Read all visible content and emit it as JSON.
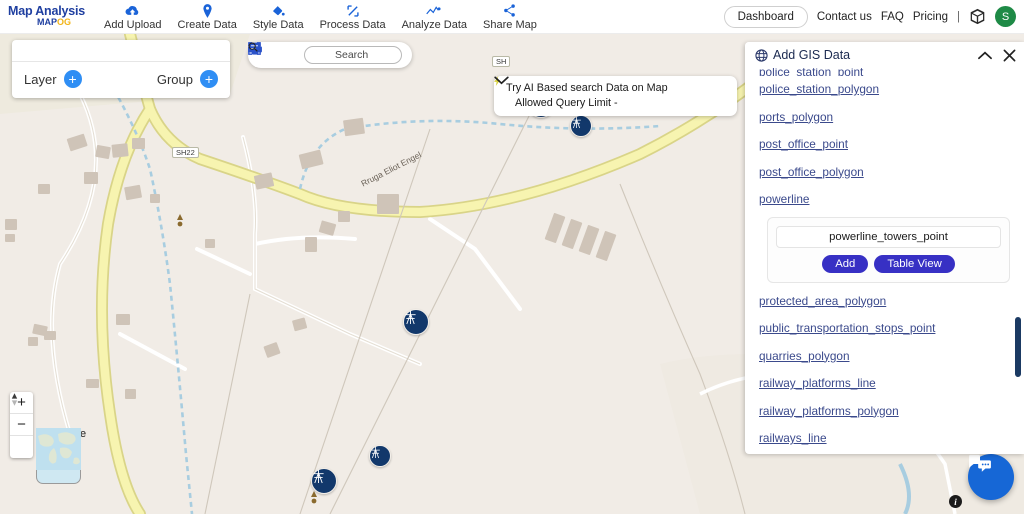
{
  "header": {
    "brand_title": "Map Analysis",
    "brand_sub_map": "MAP",
    "brand_sub_og": "OG",
    "nav": [
      {
        "label": "Add Upload",
        "icon": "cloud-upload-icon"
      },
      {
        "label": "Create Data",
        "icon": "map-pin-icon"
      },
      {
        "label": "Style Data",
        "icon": "paint-bucket-icon"
      },
      {
        "label": "Process Data",
        "icon": "transform-icon"
      },
      {
        "label": "Analyze Data",
        "icon": "analytics-icon"
      },
      {
        "label": "Share Map",
        "icon": "share-icon"
      }
    ],
    "dashboard_label": "Dashboard",
    "contact_label": "Contact us",
    "faq_label": "FAQ",
    "pricing_label": "Pricing",
    "separator": "|",
    "cube_icon": "cube-icon",
    "avatar_initial": "S"
  },
  "layer_panel": {
    "layer_label": "Layer",
    "group_label": "Group",
    "add_symbol": "+"
  },
  "map_toolbar": {
    "icons": [
      "fullscreen-icon",
      "print-icon",
      "filter-sliders-icon",
      "comment-icon"
    ],
    "search_placeholder": "Search",
    "search_value": "",
    "search_icon": "search-icon"
  },
  "ai_banner": {
    "line1": "Try AI Based search Data on Map",
    "line2": "Allowed Query Limit -",
    "bolt_icon": "lightning-bolt-icon",
    "chevron_icon": "chevron-down-icon"
  },
  "map_controls": {
    "zoom_in": "+",
    "zoom_out": "−",
    "compass_icon": "compass-icon",
    "map_type_label": "Map Type",
    "info_label": "i",
    "chat_icon": "chat-bubbles-icon"
  },
  "map_labels": {
    "road_name": "Rruga Eliot Engel",
    "shield_1": "SH22",
    "shield_2": "SH",
    "marker_icon": "powerline-tower-icon"
  },
  "gis_panel": {
    "title": "Add GIS Data",
    "globe_icon": "globe-icon",
    "collapse_icon": "chevron-up-icon",
    "close_icon": "close-icon",
    "clipped_item": "police_station_point",
    "items_before": [
      "police_station_polygon",
      "ports_polygon",
      "post_office_point",
      "post_office_polygon",
      "powerline"
    ],
    "popup": {
      "layer_name": "powerline_towers_point",
      "add_label": "Add",
      "table_view_label": "Table View"
    },
    "items_after": [
      "protected_area_polygon",
      "public_transportation_stops_point",
      "quarries_polygon",
      "railway_platforms_line",
      "railway_platforms_polygon",
      "railways_line"
    ]
  },
  "colors": {
    "brand_blue": "#1f3fa0",
    "accent_blue": "#2f8ef4",
    "link_indigo": "#3b4a8c",
    "button_indigo": "#3730c4",
    "marker_navy": "#12386b",
    "avatar_green": "#1e8a46",
    "map_bg": "#f1ece6",
    "road_yellow": "#f2efab",
    "water_blue": "#a8cde0"
  }
}
